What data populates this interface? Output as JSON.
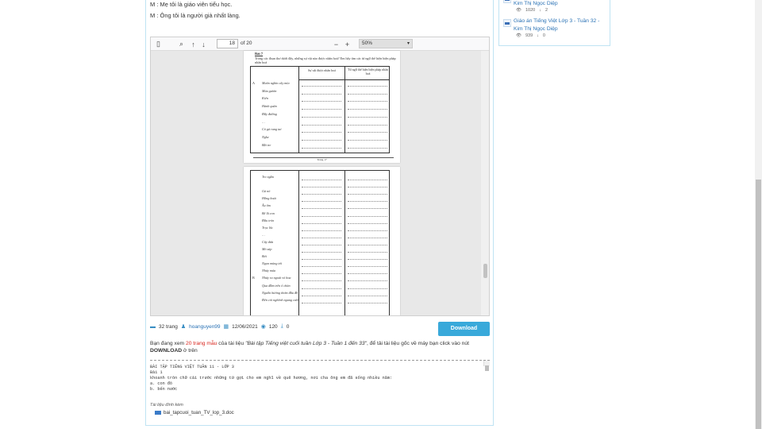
{
  "intro": {
    "lines": [
      "M : Mẹ tôi là giáo viên tiểu học.",
      "M : Ông tôi là người già nhất làng."
    ]
  },
  "viewer": {
    "toolbar": {
      "sidebar_icon": "sidebar-toggle-icon",
      "search_icon": "search-icon",
      "prev_icon": "arrow-up-icon",
      "next_icon": "arrow-down-icon",
      "page_value": "18",
      "page_of": "of 20",
      "zoom_out": "−",
      "zoom_in": "+",
      "zoom_value": "50%"
    },
    "page1": {
      "title": "Bài 7",
      "instruction": "Trong các đoạn thơ dưới đây, những sự vật nào được nhân hoá? Em hãy tìm các từ ngữ thể hiện biện pháp nhân hoá",
      "col1": "Sự vật được nhân hoá",
      "col2": "Từ ngữ thể hiện biện pháp nhân hoá",
      "rows": [
        "Muôn nghìn cây mía",
        "Múa gươm",
        "Kiến",
        "Hành quân",
        "Đầy đường",
        "…",
        "Cỏ gà rung tai",
        "Nghe",
        "Bầi tre"
      ],
      "row_prefix": "A",
      "footer": "Trang 17"
    },
    "page2": {
      "rows": [
        "Tre ngần",
        "",
        "Gà nó",
        "Hồng hoát",
        "Âu ôm",
        "Bế lũ con",
        "Đầu tròn",
        "Trọc lốc",
        "…",
        "Cây dừa",
        "Mỏ sáp",
        "Bơi",
        "Ngọn mùng tơi",
        "Nhảy múa",
        "Nhảy ra ngoài vỏ hoa",
        "Qua đầm trên ổ chăn",
        "Nguồn hương thơm đầu đồ",
        "Đến còi nghênh ngang cười"
      ],
      "row_prefix_index": 14,
      "row_prefix": "B"
    }
  },
  "meta": {
    "pages": "32 trang",
    "author": "hoanguyen99",
    "date": "12/06/2021",
    "views": "120",
    "downloads": "0"
  },
  "download_button": "Download",
  "description": {
    "part1": "Bạn đang xem ",
    "pages_red": "20 trang mẫu",
    "part2": " của tài liệu ",
    "title_italic": "\"Bài tập Tiếng việt cuối tuần Lớp 3 - Tuần 1 đến 33\"",
    "part3": ", để tải tài liệu gốc về máy bạn click vào nút ",
    "bold": "DOWNLOAD",
    "part4": " ở trên"
  },
  "preview_lines": [
    "BÀI TẬP TIẾNG VIỆT TUẦN 11 - LỚP 3",
    "Bài 1",
    "khoanh tròn chữ cái trước những từ gợi cho em nghĩ về quê hương, nơi cha ông em đã sống nhiều năm:",
    "a. con đò",
    "b. bến nước"
  ],
  "related": {
    "label": "Tài liệu đính kèm",
    "file": "bai_tapcuoi_tuan_TV_lop_3.doc"
  },
  "sidebar": {
    "items": [
      {
        "title_line": "Kim Thị Ngọc Diệp",
        "views": "1020",
        "downloads": "2"
      },
      {
        "title": "Giáo án Tiếng Việt Lớp 3 - Tuần 32 - Kim Thị Ngọc Diệp",
        "views": "939",
        "downloads": "0"
      }
    ]
  },
  "colors": {
    "accent": "#39a9da",
    "link": "#2a72b5",
    "red": "#d9241c"
  }
}
